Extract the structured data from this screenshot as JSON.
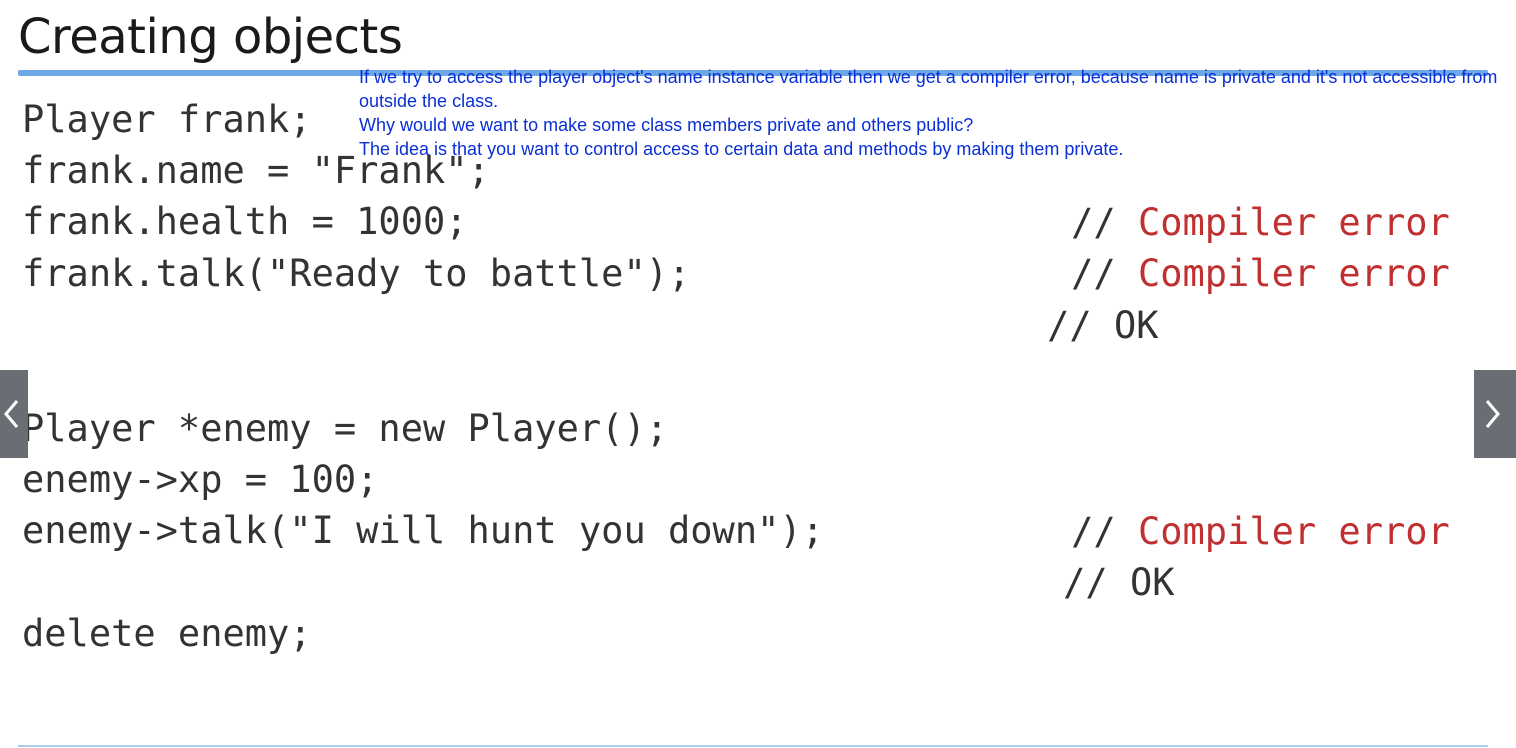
{
  "slide": {
    "title": "Creating objects"
  },
  "code_lines": [
    "Player frank;",
    "frank.name = \"Frank\";",
    "frank.health = 1000;",
    "frank.talk(\"Ready to battle\");",
    "Player *enemy = new Player();",
    "enemy->xp = 100;",
    "enemy->talk(\"I will hunt you down\");",
    "delete enemy;"
  ],
  "comments": {
    "slashes": "//",
    "compiler_error": "Compiler error",
    "ok": "OK"
  },
  "caption": {
    "lines": [
      "If we try to access the player object's name instance variable then we get a compiler error, because name is private and it's not accessible from outside the class.",
      "Why would we want to make some class members private and others public?",
      "The idea is that you want to control access to certain data and methods by making them private."
    ]
  },
  "navigation": {
    "prev_icon": "chevron-left-icon",
    "next_icon": "chevron-right-icon"
  },
  "colors": {
    "title_rule": "#6fa8e8",
    "error_text": "#c03030",
    "caption_text": "#0a2fd6",
    "nav_background": "#6a6d73"
  }
}
